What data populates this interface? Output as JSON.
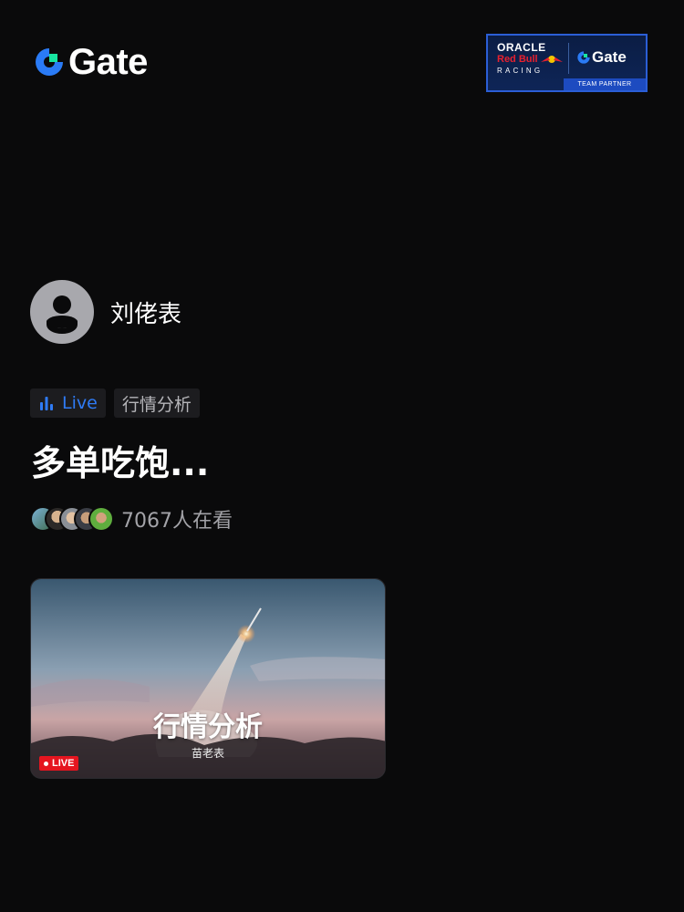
{
  "header": {
    "logo_text": "Gate",
    "partner": {
      "oracle": "ORACLE",
      "redbull": "Red Bull",
      "racing": "RACING",
      "gate": "Gate",
      "team_partner": "TEAM PARTNER"
    }
  },
  "host": {
    "name": "刘佬表"
  },
  "tags": {
    "live": "Live",
    "category": "行情分析"
  },
  "stream": {
    "title": "多单吃饱...",
    "viewer_count": "7067人在看"
  },
  "card": {
    "title": "行情分析",
    "subtitle": "苗老表",
    "badge": "LIVE"
  },
  "colors": {
    "accent": "#2f7bf5",
    "live_red": "#e5151f",
    "logo_green": "#17e5a0",
    "logo_blue": "#2a7bf6"
  }
}
